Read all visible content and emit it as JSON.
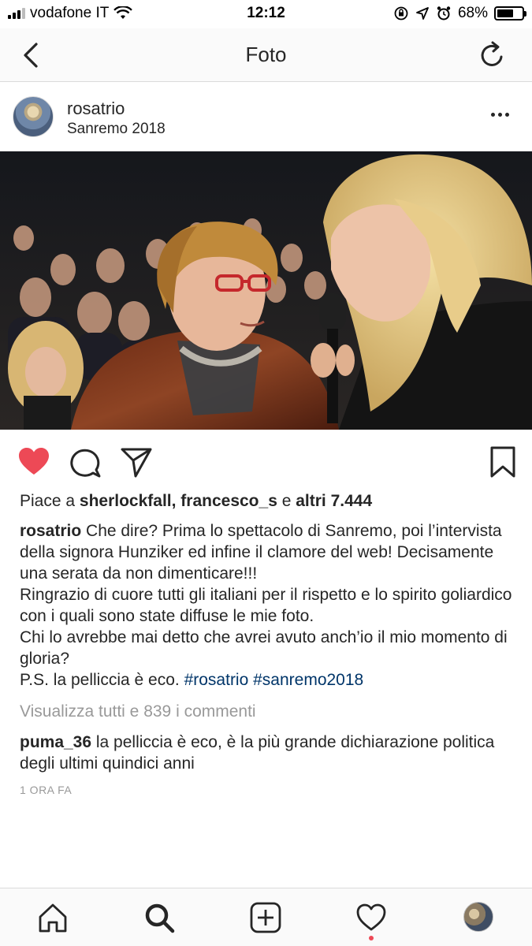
{
  "status_bar": {
    "carrier": "vodafone IT",
    "time": "12:12",
    "battery_percent": "68%",
    "battery_level": 0.68
  },
  "nav": {
    "title": "Foto",
    "back_icon": "chevron-left-icon",
    "refresh_icon": "refresh-icon"
  },
  "post": {
    "username": "rosatrio",
    "location": "Sanremo 2018",
    "liked": true,
    "likes": {
      "prefix": "Piace a ",
      "user1": "sherlockfall",
      "sep": ", ",
      "user2": "francesco_s",
      "and": " e ",
      "others": "altri 7.444"
    },
    "caption": {
      "author": "rosatrio",
      "line1": " Che dire? Prima lo spettacolo di Sanremo, poi l’intervista della signora Hunziker ed infine il clamore del web! Decisamente una serata da non dimenticare!!!",
      "line2": "Ringrazio di cuore tutti gli italiani per il rispetto e lo spirito goliardico con i quali sono state diffuse le mie foto.",
      "line3": "Chi lo avrebbe mai detto che avrei avuto anch’io il mio momento di gloria?",
      "line4_text": "P.S. la pelliccia è eco. ",
      "hashtag1": "#rosatrio",
      "hashtag2": "#sanremo2018"
    },
    "view_comments": "Visualizza tutti e 839 i commenti",
    "comment": {
      "author": "puma_36",
      "text": " la pelliccia è eco, è la più grande dichiarazione politica degli ultimi quindici anni"
    },
    "timestamp": "1 ORA FA"
  },
  "colors": {
    "like_red": "#ed4956",
    "hashtag_blue": "#003569",
    "muted_gray": "#999999"
  },
  "tabbar": {
    "items": [
      "home-icon",
      "search-icon",
      "add-post-icon",
      "activity-heart-icon",
      "profile-avatar"
    ]
  }
}
